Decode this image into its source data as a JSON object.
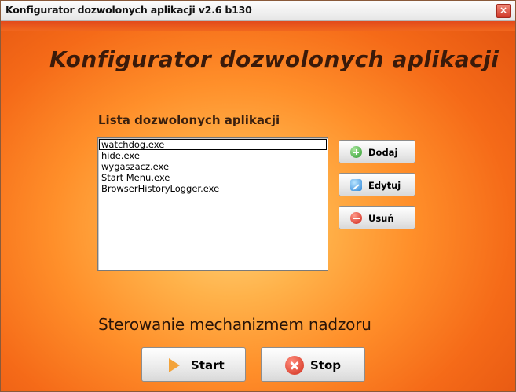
{
  "window": {
    "title": "Konfigurator dozwolonych aplikacji v2.6 b130",
    "close_icon": "close-icon"
  },
  "main": {
    "heading": "Konfigurator dozwolonych aplikacji",
    "list_label": "Lista dozwolonych aplikacji",
    "apps": [
      {
        "name": "watchdog.exe",
        "selected": true
      },
      {
        "name": "hide.exe",
        "selected": false
      },
      {
        "name": "wygaszacz.exe",
        "selected": false
      },
      {
        "name": "Start Menu.exe",
        "selected": false
      },
      {
        "name": "BrowserHistoryLogger.exe",
        "selected": false
      }
    ],
    "buttons": {
      "add_label": "Dodaj",
      "edit_label": "Edytuj",
      "remove_label": "Usuń"
    }
  },
  "control": {
    "heading": "Sterowanie mechanizmem nadzoru",
    "start_label": "Start",
    "stop_label": "Stop"
  },
  "colors": {
    "background_center": "#ffd27a",
    "background_edge": "#e0500f",
    "title_stripe": "#e24a1c"
  }
}
